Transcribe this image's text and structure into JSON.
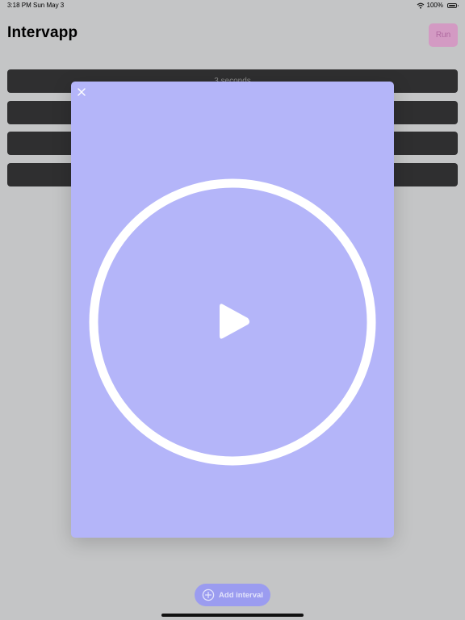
{
  "status_bar": {
    "time": "3:18 PM",
    "date": "Sun May 3",
    "battery": "100%",
    "icons": [
      "wifi-icon",
      "battery-icon"
    ]
  },
  "header": {
    "title": "Intervapp",
    "run_label": "Run"
  },
  "intervals": [
    {
      "label": "3 seconds"
    },
    {
      "label": ""
    },
    {
      "label": ""
    },
    {
      "label": ""
    }
  ],
  "modal": {
    "close_icon": "close-icon",
    "play_icon": "play-icon"
  },
  "footer": {
    "add_label": "Add interval",
    "add_icon": "plus-circle-icon"
  },
  "colors": {
    "modal_background": "#b4b5f9",
    "run_button": "#d39ac3",
    "add_button": "#9b9cf0",
    "interval_row": "#2f2f30"
  }
}
